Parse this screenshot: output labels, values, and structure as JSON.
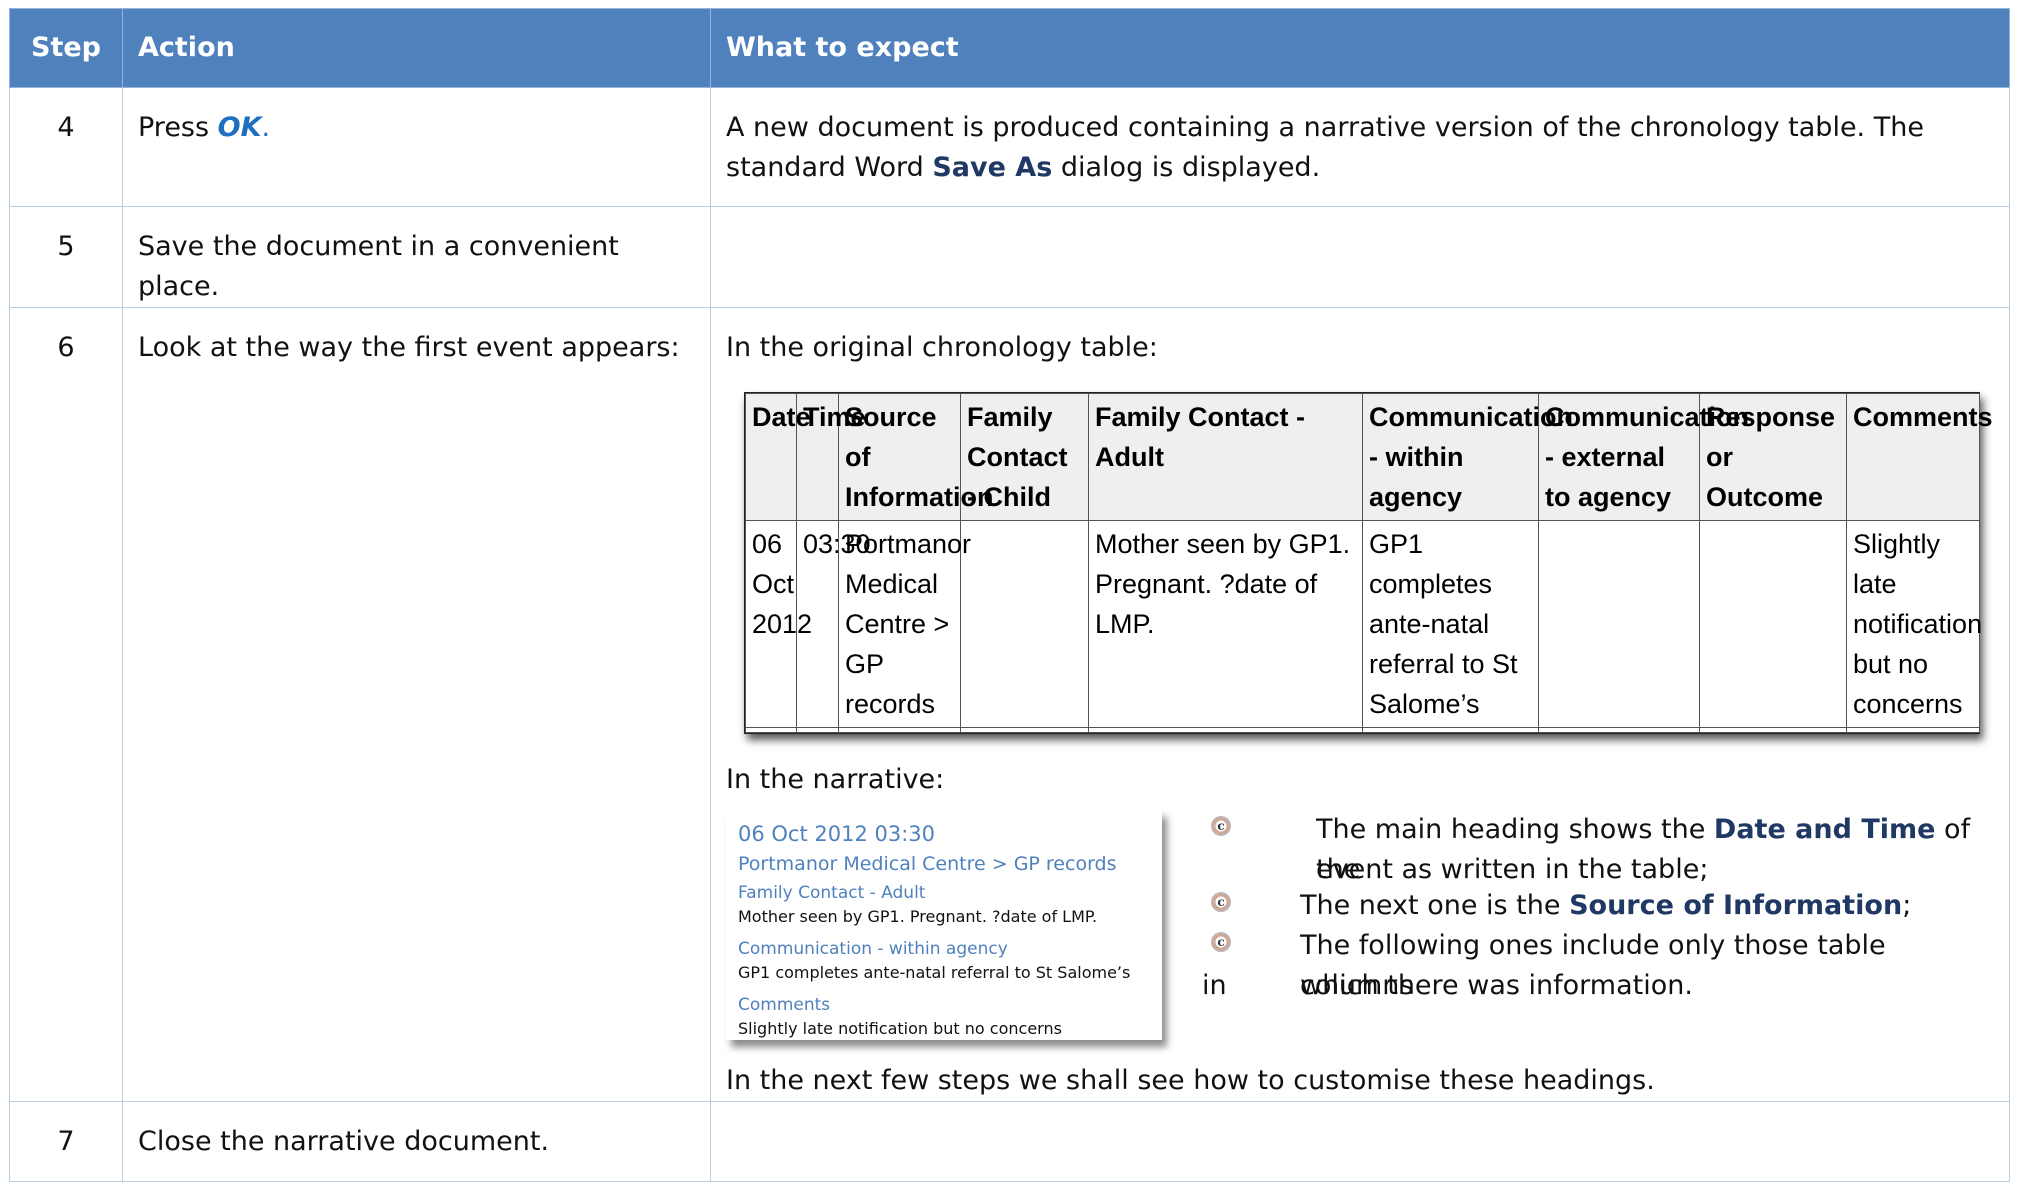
{
  "header": {
    "step": "Step",
    "action": "Action",
    "expect": "What to expect"
  },
  "rows": {
    "r4": {
      "step": "4",
      "action_prefix": "Press ",
      "action_ok": "OK",
      "action_suffix": ".",
      "expect_1": "A new document is produced containing a narrative version of the chronology table. The standard Word ",
      "expect_bold": "Save As",
      "expect_2": " dialog is displayed."
    },
    "r5": {
      "step": "5",
      "action": "Save the document in a convenient place."
    },
    "r6": {
      "step": "6",
      "action": "Look at the way the first event appears:",
      "intro": "In the original chronology table:",
      "narrative_intro": "In the narrative:",
      "outro": "In the next few steps we shall see how to customise these headings."
    },
    "r7": {
      "step": "7",
      "action": "Close the narrative document."
    }
  },
  "chronology": {
    "headers": [
      "Date",
      "Time",
      "Source of Information",
      "Family Contact - Child",
      "Family Contact - Adult",
      "Communication - within agency",
      "Communication - external to agency",
      "Response or Outcome",
      "Comments"
    ],
    "row": [
      "06 Oct 2012",
      "03:30",
      "Portmanor Medical Centre > GP records",
      "",
      "Mother seen by GP1. Pregnant. ?date of LMP.",
      "GP1 completes ante-natal referral to St Salome’s",
      "",
      "",
      "Slightly late notification but no concerns"
    ]
  },
  "narrative": {
    "heading": "06 Oct 2012 03:30",
    "source": "Portmanor Medical Centre > GP records",
    "label_1": "Family Contact - Adult",
    "text_1": "Mother seen by GP1. Pregnant. ?date of LMP.",
    "label_2": "Communication - within agency",
    "text_2": "GP1 completes ante-natal referral to St Salome’s",
    "label_3": "Comments",
    "text_3": "Slightly late notification but no concerns"
  },
  "bullets": {
    "glyph": "c",
    "b1_pre": "The main heading shows the ",
    "b1_bold": "Date and Time",
    "b1_post": " of the",
    "b1_line2": "event as written in the table;",
    "b2_pre": "The next one is the ",
    "b2_bold": "Source of Information",
    "b2_post": ";",
    "b3_line1": "The following ones include only those table columns",
    "b3_in": "in",
    "b3_line2": "which there was information."
  },
  "colors": {
    "header_bg": "#4f81bd",
    "border": "#b8cce4",
    "accent": "#1f6fc1",
    "navy": "#1f3864"
  }
}
